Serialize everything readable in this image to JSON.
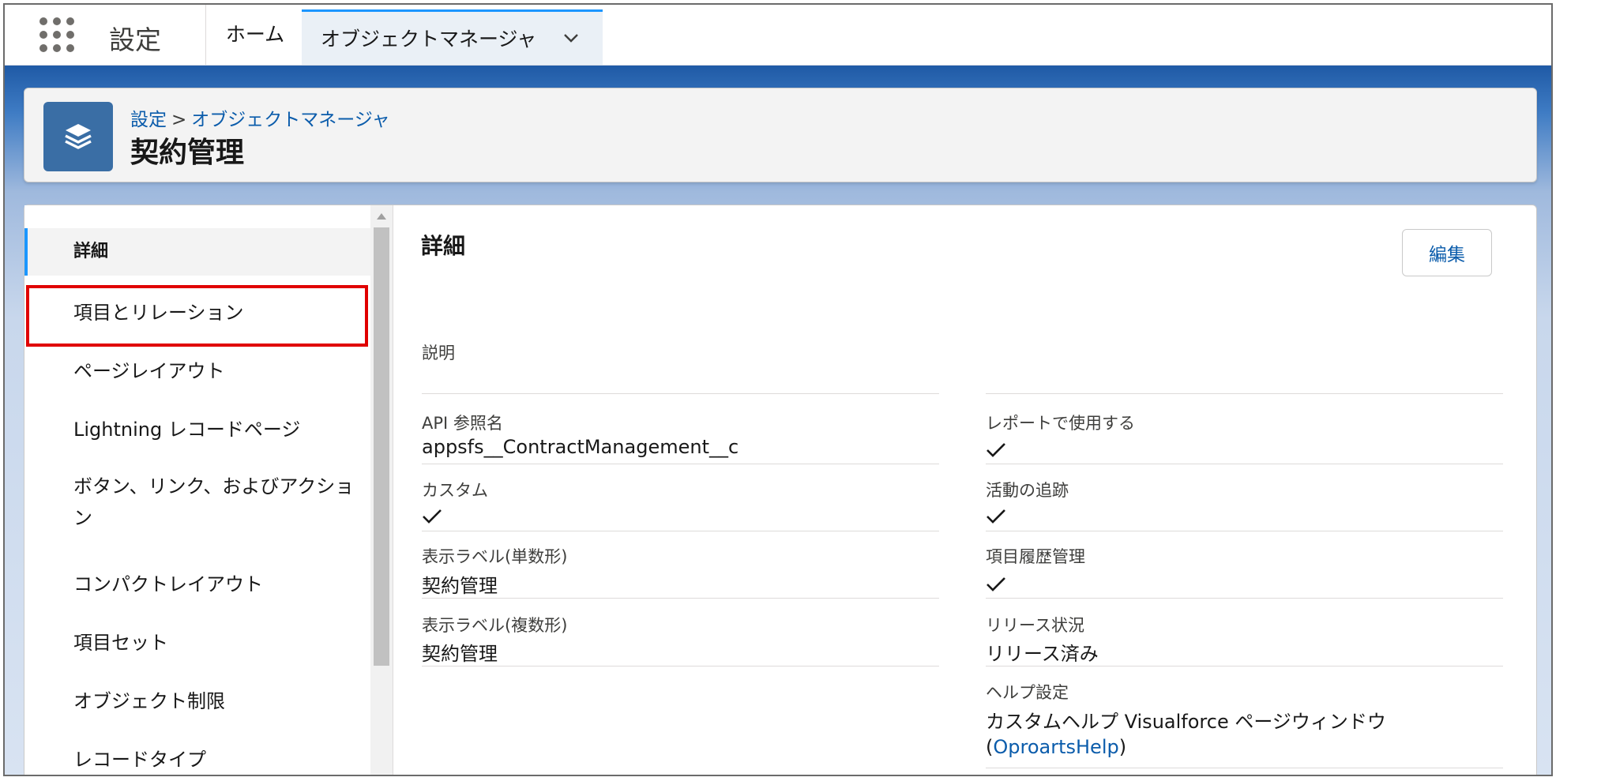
{
  "topbar": {
    "app_title": "設定",
    "tabs": [
      {
        "label": "ホーム"
      },
      {
        "label": "オブジェクトマネージャ"
      }
    ]
  },
  "header": {
    "breadcrumb_root": "設定",
    "breadcrumb_sep": ">",
    "breadcrumb_current": "オブジェクトマネージャ",
    "title": "契約管理",
    "icon": "layers-icon"
  },
  "sidebar": {
    "items": [
      {
        "label": "詳細"
      },
      {
        "label": "項目とリレーション"
      },
      {
        "label": "ページレイアウト"
      },
      {
        "label": "Lightning レコードページ"
      },
      {
        "label": "ボタン、リンク、およびアクション"
      },
      {
        "label": "コンパクトレイアウト"
      },
      {
        "label": "項目セット"
      },
      {
        "label": "オブジェクト制限"
      },
      {
        "label": "レコードタイプ"
      }
    ]
  },
  "detail": {
    "title": "詳細",
    "edit_label": "編集",
    "description_label": "説明",
    "api_name_label": "API 参照名",
    "api_name_value": "appsfs__ContractManagement__c",
    "custom_label": "カスタム",
    "label_singular_label": "表示ラベル(単数形)",
    "label_singular_value": "契約管理",
    "label_plural_label": "表示ラベル(複数形)",
    "label_plural_value": "契約管理",
    "report_label": "レポートで使用する",
    "activity_label": "活動の追跡",
    "history_label": "項目履歴管理",
    "release_label": "リリース状況",
    "release_value": "リリース済み",
    "help_label": "ヘルプ設定",
    "help_value": "カスタムヘルプ Visualforce ページウィンドウ",
    "help_link_open": "(",
    "help_link": "OproartsHelp",
    "help_link_close": ")"
  }
}
